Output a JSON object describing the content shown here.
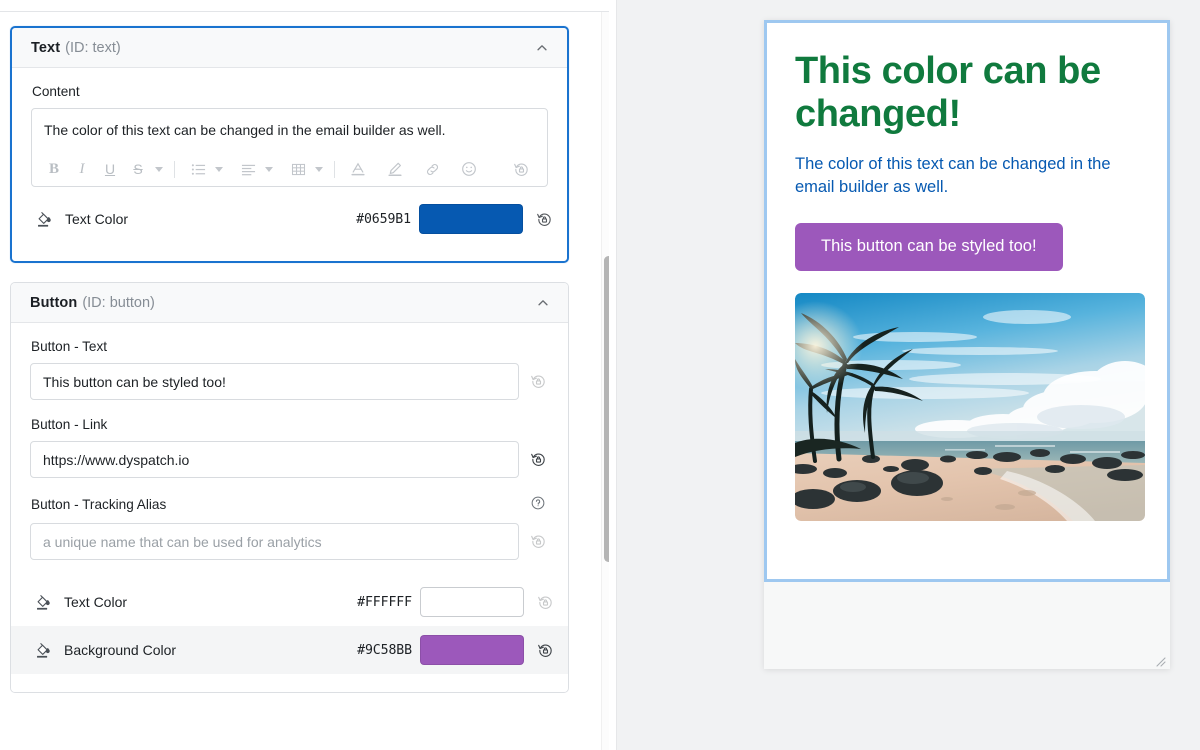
{
  "editor": {
    "sections": [
      {
        "title": "Text",
        "id_label": "(ID: text)",
        "collapse_icon": "chevron-up-icon",
        "fields": {
          "content_label": "Content",
          "content_value": "The color of this text can be changed in the email builder as well.",
          "toolbar": [
            {
              "name": "bold-icon",
              "glyph": "B"
            },
            {
              "name": "italic-icon",
              "glyph": "I"
            },
            {
              "name": "underline-icon",
              "glyph": "U"
            },
            {
              "name": "strikethrough-icon",
              "glyph": "S"
            },
            {
              "name": "bullet-list-icon",
              "glyph": "list"
            },
            {
              "name": "align-icon",
              "glyph": "align"
            },
            {
              "name": "table-icon",
              "glyph": "table"
            },
            {
              "name": "font-color-icon",
              "glyph": "A"
            },
            {
              "name": "highlight-icon",
              "glyph": "pen"
            },
            {
              "name": "link-icon",
              "glyph": "chain"
            },
            {
              "name": "emoji-icon",
              "glyph": "smiley"
            },
            {
              "name": "revert-icon",
              "glyph": "revert"
            }
          ]
        },
        "colors": [
          {
            "label": "Text Color",
            "hex": "#0659B1",
            "swatch": "#0659B1",
            "white": false
          }
        ]
      },
      {
        "title": "Button",
        "id_label": "(ID: button)",
        "collapse_icon": "chevron-up-icon",
        "fields": {
          "text_label": "Button - Text",
          "text_value": "This button can be styled too!",
          "link_label": "Button - Link",
          "link_value": "https://www.dyspatch.io",
          "alias_label": "Button - Tracking Alias",
          "alias_value": "",
          "alias_placeholder": "a unique name that can be used for analytics",
          "alias_help_icon": "help-circle-icon"
        },
        "colors": [
          {
            "label": "Text Color",
            "hex": "#FFFFFF",
            "swatch": "#FFFFFF",
            "white": true
          },
          {
            "label": "Background Color",
            "hex": "#9C58BB",
            "swatch": "#9C58BB",
            "white": false
          }
        ]
      }
    ]
  },
  "preview": {
    "heading": "This color can be changed!",
    "heading_color": "#107A3E",
    "paragraph": "The color of this text can be changed in the email builder as well.",
    "paragraph_color": "#0659B1",
    "button_label": "This button can be styled too!",
    "button_bg": "#9C58BB",
    "button_text_color": "#FFFFFF",
    "image_alt": "tropical-beach-photo",
    "border_color": "#9EC8F0",
    "resize_handle_icon": "resize-grip-icon"
  },
  "scrollbar": {
    "name": "left-panel-scrollbar"
  }
}
